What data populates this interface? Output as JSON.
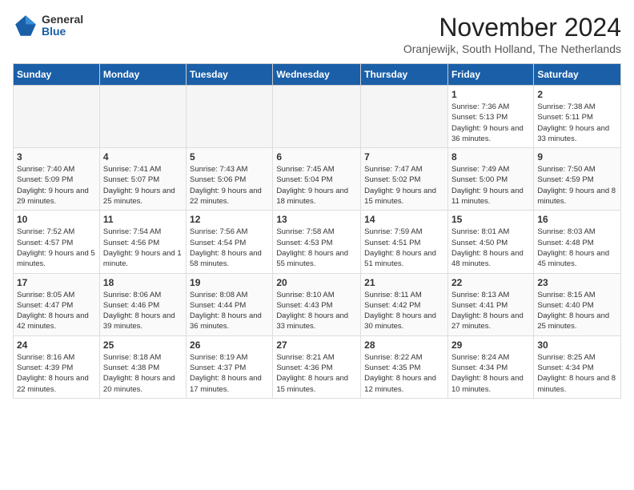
{
  "logo": {
    "general": "General",
    "blue": "Blue"
  },
  "header": {
    "month_title": "November 2024",
    "location": "Oranjewijk, South Holland, The Netherlands"
  },
  "weekdays": [
    "Sunday",
    "Monday",
    "Tuesday",
    "Wednesday",
    "Thursday",
    "Friday",
    "Saturday"
  ],
  "weeks": [
    [
      {
        "day": "",
        "info": ""
      },
      {
        "day": "",
        "info": ""
      },
      {
        "day": "",
        "info": ""
      },
      {
        "day": "",
        "info": ""
      },
      {
        "day": "",
        "info": ""
      },
      {
        "day": "1",
        "info": "Sunrise: 7:36 AM\nSunset: 5:13 PM\nDaylight: 9 hours and 36 minutes."
      },
      {
        "day": "2",
        "info": "Sunrise: 7:38 AM\nSunset: 5:11 PM\nDaylight: 9 hours and 33 minutes."
      }
    ],
    [
      {
        "day": "3",
        "info": "Sunrise: 7:40 AM\nSunset: 5:09 PM\nDaylight: 9 hours and 29 minutes."
      },
      {
        "day": "4",
        "info": "Sunrise: 7:41 AM\nSunset: 5:07 PM\nDaylight: 9 hours and 25 minutes."
      },
      {
        "day": "5",
        "info": "Sunrise: 7:43 AM\nSunset: 5:06 PM\nDaylight: 9 hours and 22 minutes."
      },
      {
        "day": "6",
        "info": "Sunrise: 7:45 AM\nSunset: 5:04 PM\nDaylight: 9 hours and 18 minutes."
      },
      {
        "day": "7",
        "info": "Sunrise: 7:47 AM\nSunset: 5:02 PM\nDaylight: 9 hours and 15 minutes."
      },
      {
        "day": "8",
        "info": "Sunrise: 7:49 AM\nSunset: 5:00 PM\nDaylight: 9 hours and 11 minutes."
      },
      {
        "day": "9",
        "info": "Sunrise: 7:50 AM\nSunset: 4:59 PM\nDaylight: 9 hours and 8 minutes."
      }
    ],
    [
      {
        "day": "10",
        "info": "Sunrise: 7:52 AM\nSunset: 4:57 PM\nDaylight: 9 hours and 5 minutes."
      },
      {
        "day": "11",
        "info": "Sunrise: 7:54 AM\nSunset: 4:56 PM\nDaylight: 9 hours and 1 minute."
      },
      {
        "day": "12",
        "info": "Sunrise: 7:56 AM\nSunset: 4:54 PM\nDaylight: 8 hours and 58 minutes."
      },
      {
        "day": "13",
        "info": "Sunrise: 7:58 AM\nSunset: 4:53 PM\nDaylight: 8 hours and 55 minutes."
      },
      {
        "day": "14",
        "info": "Sunrise: 7:59 AM\nSunset: 4:51 PM\nDaylight: 8 hours and 51 minutes."
      },
      {
        "day": "15",
        "info": "Sunrise: 8:01 AM\nSunset: 4:50 PM\nDaylight: 8 hours and 48 minutes."
      },
      {
        "day": "16",
        "info": "Sunrise: 8:03 AM\nSunset: 4:48 PM\nDaylight: 8 hours and 45 minutes."
      }
    ],
    [
      {
        "day": "17",
        "info": "Sunrise: 8:05 AM\nSunset: 4:47 PM\nDaylight: 8 hours and 42 minutes."
      },
      {
        "day": "18",
        "info": "Sunrise: 8:06 AM\nSunset: 4:46 PM\nDaylight: 8 hours and 39 minutes."
      },
      {
        "day": "19",
        "info": "Sunrise: 8:08 AM\nSunset: 4:44 PM\nDaylight: 8 hours and 36 minutes."
      },
      {
        "day": "20",
        "info": "Sunrise: 8:10 AM\nSunset: 4:43 PM\nDaylight: 8 hours and 33 minutes."
      },
      {
        "day": "21",
        "info": "Sunrise: 8:11 AM\nSunset: 4:42 PM\nDaylight: 8 hours and 30 minutes."
      },
      {
        "day": "22",
        "info": "Sunrise: 8:13 AM\nSunset: 4:41 PM\nDaylight: 8 hours and 27 minutes."
      },
      {
        "day": "23",
        "info": "Sunrise: 8:15 AM\nSunset: 4:40 PM\nDaylight: 8 hours and 25 minutes."
      }
    ],
    [
      {
        "day": "24",
        "info": "Sunrise: 8:16 AM\nSunset: 4:39 PM\nDaylight: 8 hours and 22 minutes."
      },
      {
        "day": "25",
        "info": "Sunrise: 8:18 AM\nSunset: 4:38 PM\nDaylight: 8 hours and 20 minutes."
      },
      {
        "day": "26",
        "info": "Sunrise: 8:19 AM\nSunset: 4:37 PM\nDaylight: 8 hours and 17 minutes."
      },
      {
        "day": "27",
        "info": "Sunrise: 8:21 AM\nSunset: 4:36 PM\nDaylight: 8 hours and 15 minutes."
      },
      {
        "day": "28",
        "info": "Sunrise: 8:22 AM\nSunset: 4:35 PM\nDaylight: 8 hours and 12 minutes."
      },
      {
        "day": "29",
        "info": "Sunrise: 8:24 AM\nSunset: 4:34 PM\nDaylight: 8 hours and 10 minutes."
      },
      {
        "day": "30",
        "info": "Sunrise: 8:25 AM\nSunset: 4:34 PM\nDaylight: 8 hours and 8 minutes."
      }
    ]
  ]
}
